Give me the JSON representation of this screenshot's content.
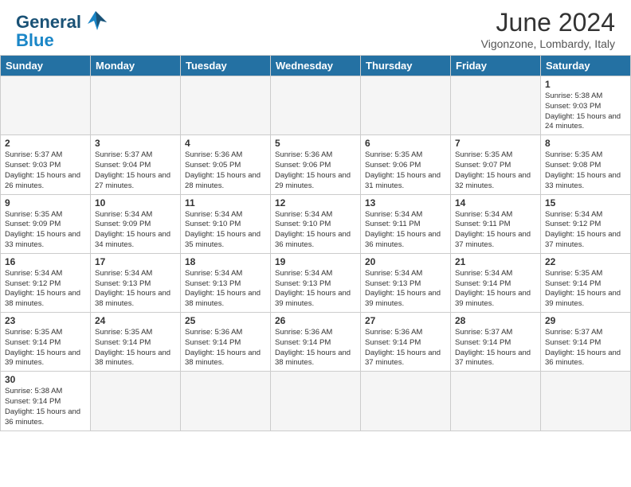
{
  "header": {
    "logo_general": "General",
    "logo_blue": "Blue",
    "month_year": "June 2024",
    "location": "Vigonzone, Lombardy, Italy"
  },
  "days_of_week": [
    "Sunday",
    "Monday",
    "Tuesday",
    "Wednesday",
    "Thursday",
    "Friday",
    "Saturday"
  ],
  "weeks": [
    [
      {
        "day": "",
        "empty": true
      },
      {
        "day": "",
        "empty": true
      },
      {
        "day": "",
        "empty": true
      },
      {
        "day": "",
        "empty": true
      },
      {
        "day": "",
        "empty": true
      },
      {
        "day": "",
        "empty": true
      },
      {
        "day": "1",
        "info": "Sunrise: 5:38 AM\nSunset: 9:03 PM\nDaylight: 15 hours and 24 minutes."
      }
    ],
    [
      {
        "day": "2",
        "info": "Sunrise: 5:37 AM\nSunset: 9:03 PM\nDaylight: 15 hours and 26 minutes."
      },
      {
        "day": "3",
        "info": "Sunrise: 5:37 AM\nSunset: 9:04 PM\nDaylight: 15 hours and 27 minutes."
      },
      {
        "day": "4",
        "info": "Sunrise: 5:36 AM\nSunset: 9:05 PM\nDaylight: 15 hours and 28 minutes."
      },
      {
        "day": "5",
        "info": "Sunrise: 5:36 AM\nSunset: 9:06 PM\nDaylight: 15 hours and 29 minutes."
      },
      {
        "day": "6",
        "info": "Sunrise: 5:35 AM\nSunset: 9:06 PM\nDaylight: 15 hours and 31 minutes."
      },
      {
        "day": "7",
        "info": "Sunrise: 5:35 AM\nSunset: 9:07 PM\nDaylight: 15 hours and 32 minutes."
      },
      {
        "day": "8",
        "info": "Sunrise: 5:35 AM\nSunset: 9:08 PM\nDaylight: 15 hours and 33 minutes."
      }
    ],
    [
      {
        "day": "9",
        "info": "Sunrise: 5:35 AM\nSunset: 9:09 PM\nDaylight: 15 hours and 33 minutes."
      },
      {
        "day": "10",
        "info": "Sunrise: 5:34 AM\nSunset: 9:09 PM\nDaylight: 15 hours and 34 minutes."
      },
      {
        "day": "11",
        "info": "Sunrise: 5:34 AM\nSunset: 9:10 PM\nDaylight: 15 hours and 35 minutes."
      },
      {
        "day": "12",
        "info": "Sunrise: 5:34 AM\nSunset: 9:10 PM\nDaylight: 15 hours and 36 minutes."
      },
      {
        "day": "13",
        "info": "Sunrise: 5:34 AM\nSunset: 9:11 PM\nDaylight: 15 hours and 36 minutes."
      },
      {
        "day": "14",
        "info": "Sunrise: 5:34 AM\nSunset: 9:11 PM\nDaylight: 15 hours and 37 minutes."
      },
      {
        "day": "15",
        "info": "Sunrise: 5:34 AM\nSunset: 9:12 PM\nDaylight: 15 hours and 37 minutes."
      }
    ],
    [
      {
        "day": "16",
        "info": "Sunrise: 5:34 AM\nSunset: 9:12 PM\nDaylight: 15 hours and 38 minutes."
      },
      {
        "day": "17",
        "info": "Sunrise: 5:34 AM\nSunset: 9:13 PM\nDaylight: 15 hours and 38 minutes."
      },
      {
        "day": "18",
        "info": "Sunrise: 5:34 AM\nSunset: 9:13 PM\nDaylight: 15 hours and 38 minutes."
      },
      {
        "day": "19",
        "info": "Sunrise: 5:34 AM\nSunset: 9:13 PM\nDaylight: 15 hours and 39 minutes."
      },
      {
        "day": "20",
        "info": "Sunrise: 5:34 AM\nSunset: 9:13 PM\nDaylight: 15 hours and 39 minutes."
      },
      {
        "day": "21",
        "info": "Sunrise: 5:34 AM\nSunset: 9:14 PM\nDaylight: 15 hours and 39 minutes."
      },
      {
        "day": "22",
        "info": "Sunrise: 5:35 AM\nSunset: 9:14 PM\nDaylight: 15 hours and 39 minutes."
      }
    ],
    [
      {
        "day": "23",
        "info": "Sunrise: 5:35 AM\nSunset: 9:14 PM\nDaylight: 15 hours and 39 minutes."
      },
      {
        "day": "24",
        "info": "Sunrise: 5:35 AM\nSunset: 9:14 PM\nDaylight: 15 hours and 38 minutes."
      },
      {
        "day": "25",
        "info": "Sunrise: 5:36 AM\nSunset: 9:14 PM\nDaylight: 15 hours and 38 minutes."
      },
      {
        "day": "26",
        "info": "Sunrise: 5:36 AM\nSunset: 9:14 PM\nDaylight: 15 hours and 38 minutes."
      },
      {
        "day": "27",
        "info": "Sunrise: 5:36 AM\nSunset: 9:14 PM\nDaylight: 15 hours and 37 minutes."
      },
      {
        "day": "28",
        "info": "Sunrise: 5:37 AM\nSunset: 9:14 PM\nDaylight: 15 hours and 37 minutes."
      },
      {
        "day": "29",
        "info": "Sunrise: 5:37 AM\nSunset: 9:14 PM\nDaylight: 15 hours and 36 minutes."
      }
    ],
    [
      {
        "day": "30",
        "info": "Sunrise: 5:38 AM\nSunset: 9:14 PM\nDaylight: 15 hours and 36 minutes."
      },
      {
        "day": "",
        "empty": true
      },
      {
        "day": "",
        "empty": true
      },
      {
        "day": "",
        "empty": true
      },
      {
        "day": "",
        "empty": true
      },
      {
        "day": "",
        "empty": true
      },
      {
        "day": "",
        "empty": true
      }
    ]
  ]
}
